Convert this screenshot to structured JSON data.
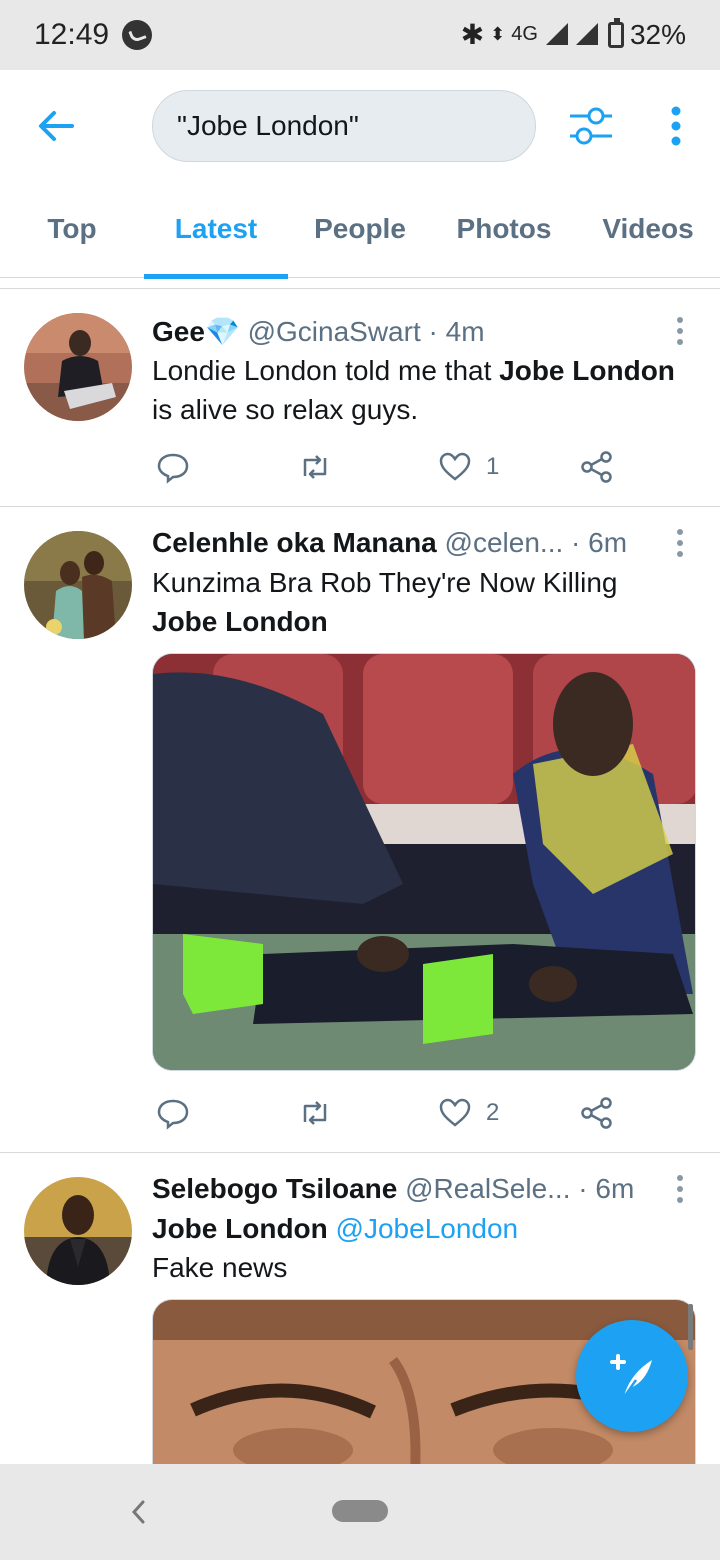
{
  "status_bar": {
    "time": "12:49",
    "network": "4G",
    "battery": "32%",
    "icons": [
      "whatsapp-icon",
      "bluetooth-icon",
      "data-arrows-icon",
      "signal-icon",
      "signal-icon",
      "battery-icon"
    ]
  },
  "header": {
    "search_value": "\"Jobe London\"",
    "icons": [
      "back-arrow-icon",
      "filter-sliders-icon",
      "more-vertical-icon"
    ]
  },
  "tabs": [
    {
      "label": "Top",
      "active": false
    },
    {
      "label": "Latest",
      "active": true
    },
    {
      "label": "People",
      "active": false
    },
    {
      "label": "Photos",
      "active": false
    },
    {
      "label": "Videos",
      "active": false
    }
  ],
  "tweets": [
    {
      "name": "Gee",
      "name_badge": "💎",
      "handle": "@GcinaSwart",
      "time": "· 4m",
      "text_plain_1": "Londie London told me that ",
      "text_bold_1": "Jobe London",
      "text_plain_2": " is alive so relax guys.",
      "likes": "1"
    },
    {
      "name": "Celenhle oka Manana",
      "handle": "@celen...",
      "time": "· 6m",
      "text_plain_1": "Kunzima Bra Rob They're Now Killing",
      "text_bold_1": "Jobe London",
      "likes": "2"
    },
    {
      "name": "Selebogo Tsiloane",
      "handle": "@RealSele...",
      "time": "· 6m",
      "text_bold_1": "Jobe London",
      "mention": "@JobeLondon",
      "text_plain_1": "Fake news"
    }
  ],
  "colors": {
    "accent": "#1da1f2",
    "secondary_text": "#5b7083",
    "primary_text": "#14171a",
    "system_bar": "#e8e8e8"
  }
}
